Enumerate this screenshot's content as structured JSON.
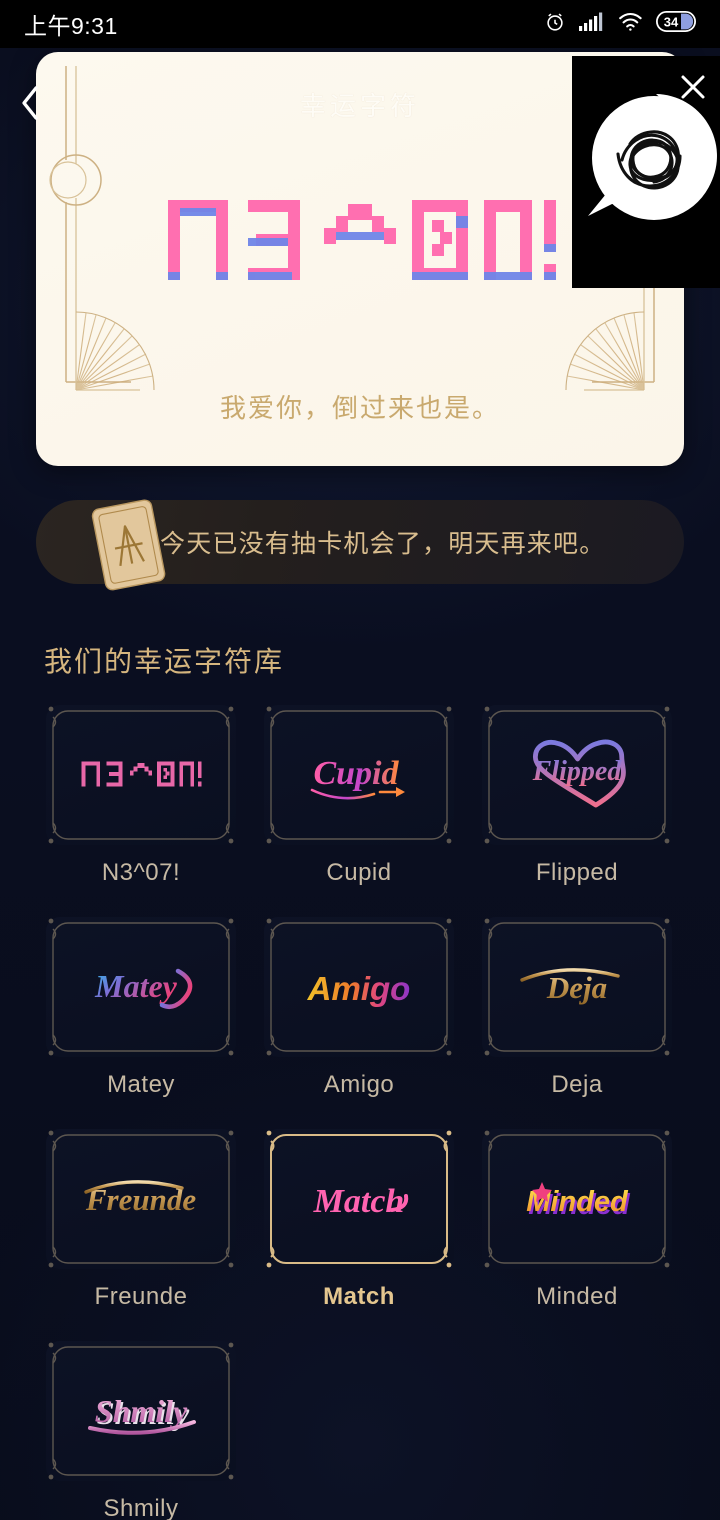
{
  "statusbar": {
    "time": "上午9:31",
    "icons": [
      "alarm-icon",
      "signal-icon",
      "wifi-icon",
      "battery-icon"
    ],
    "battery_level": "34"
  },
  "nav": {
    "back_label": "‹",
    "back_icon": "chevron-left-icon"
  },
  "fortune_card": {
    "title": "幸运字符",
    "glyph_text": "N3^07!",
    "subtitle": "我爱你，倒过来也是。",
    "bg_color": "#fdf9ef",
    "border_color": "#c9a96e",
    "glyph_color": "#ff6fb0",
    "glyph_shadow_color": "#6f86e8"
  },
  "overlay": {
    "close_icon": "close-icon",
    "bubble_icon": "speech-bubble-scribble-icon",
    "bg_color": "#000000"
  },
  "notice": {
    "icon": "card-deck-icon",
    "text": "今天已没有抽卡机会了，明天再来吧。",
    "text_color": "#d9bd8e"
  },
  "library": {
    "section_title": "我们的幸运字符库",
    "title_color": "#d5b57e",
    "items": [
      {
        "label": "N3^07!",
        "style": "pixel",
        "selected": false
      },
      {
        "label": "Cupid",
        "style": "script",
        "selected": false
      },
      {
        "label": "Flipped",
        "style": "heart",
        "selected": false
      },
      {
        "label": "Matey",
        "style": "gradient",
        "selected": false
      },
      {
        "label": "Amigo",
        "style": "playful",
        "selected": false
      },
      {
        "label": "Deja",
        "style": "gold",
        "selected": false
      },
      {
        "label": "Freunde",
        "style": "gold",
        "selected": false
      },
      {
        "label": "Match",
        "style": "pink",
        "selected": true
      },
      {
        "label": "Minded",
        "style": "bold3d",
        "selected": false
      },
      {
        "label": "Shmily",
        "style": "retro",
        "selected": false
      }
    ]
  }
}
